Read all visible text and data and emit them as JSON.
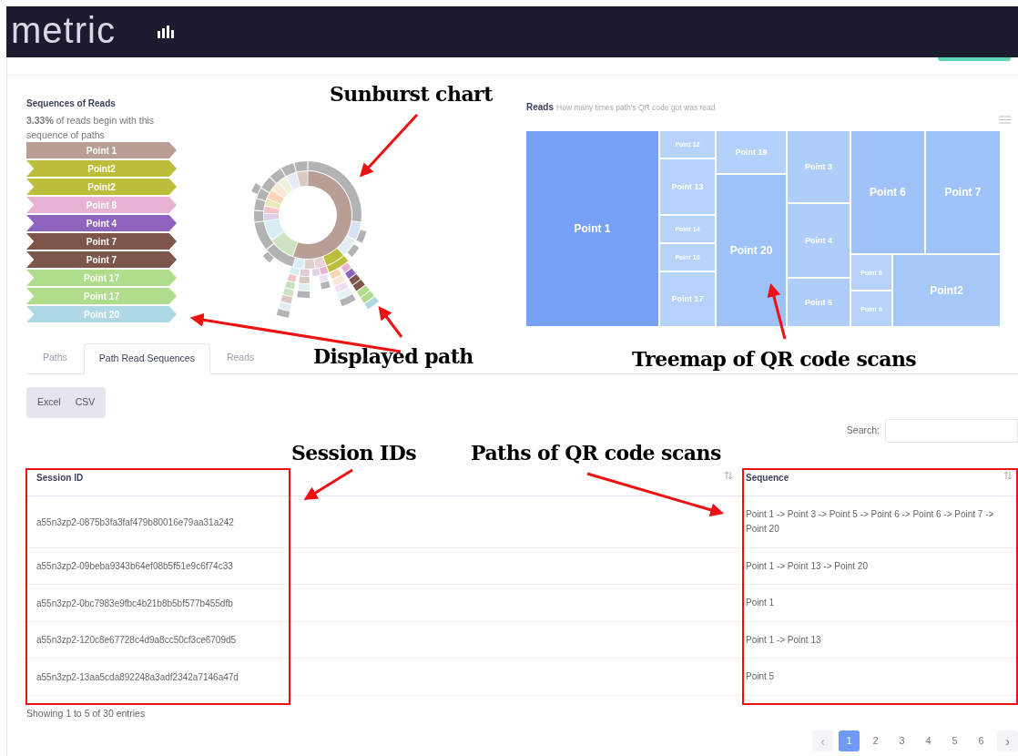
{
  "app": {
    "logo": "metric"
  },
  "sequences_panel": {
    "title": "Sequences of Reads",
    "summary": "**3.33%** of reads begin with this sequence of paths",
    "path": [
      {
        "label": "Point 1",
        "color": "#b89e94"
      },
      {
        "label": "Point2",
        "color": "#bcbd3a"
      },
      {
        "label": "Point2",
        "color": "#bcbd3a"
      },
      {
        "label": "Point 8",
        "color": "#e8b3d3"
      },
      {
        "label": "Point 4",
        "color": "#8d65bf"
      },
      {
        "label": "Point 7",
        "color": "#7d554a"
      },
      {
        "label": "Point 7",
        "color": "#7d554a"
      },
      {
        "label": "Point 17",
        "color": "#b0dd8b"
      },
      {
        "label": "Point 17",
        "color": "#b0dd8b"
      },
      {
        "label": "Point 20",
        "color": "#aed8e4"
      }
    ]
  },
  "treemap": {
    "title": "Reads",
    "subtitle": "How many times path's QR code got was read",
    "tiles": [
      {
        "label": "Point 1",
        "color": "#76a1f7"
      },
      {
        "label": "Point 12",
        "color": "#b8d3fa"
      },
      {
        "label": "Point 13",
        "color": "#b6d2fa"
      },
      {
        "label": "Point 14",
        "color": "#b8d3fa"
      },
      {
        "label": "Point 16",
        "color": "#b8d3fa"
      },
      {
        "label": "Point 17",
        "color": "#b6d2fa"
      },
      {
        "label": "Point 19",
        "color": "#b3d0fa"
      },
      {
        "label": "Point 20",
        "color": "#9dc2f8"
      },
      {
        "label": "Point 3",
        "color": "#afcdf9"
      },
      {
        "label": "Point 4",
        "color": "#afcdf9"
      },
      {
        "label": "Point 5",
        "color": "#afcdf9"
      },
      {
        "label": "Point 6",
        "color": "#9fc3f8"
      },
      {
        "label": "Point 7",
        "color": "#9fc3f8"
      },
      {
        "label": "Point 8",
        "color": "#b8d3fa"
      },
      {
        "label": "Point 9",
        "color": "#b8d3fa"
      },
      {
        "label": "Point2",
        "color": "#a6c8f9"
      }
    ]
  },
  "tabs": [
    {
      "label": "Paths",
      "selected": false
    },
    {
      "label": "Path Read Sequences",
      "selected": true
    },
    {
      "label": "Reads",
      "selected": false
    }
  ],
  "export_buttons": [
    "Excel",
    "CSV"
  ],
  "search": {
    "label": "Search:"
  },
  "table": {
    "columns": [
      "Session ID",
      "Sequence"
    ],
    "rows": [
      [
        "a55n3zp2-0875b3fa3faf479b80016e79aa31a242",
        "Point 1 -> Point 3 -> Point 5 -> Point 6 -> Point 6 -> Point 7 -> Point 20"
      ],
      [
        "a55n3zp2-09beba9343b64ef08b5f51e9c6f74c33",
        "Point 1 -> Point 13 -> Point 20"
      ],
      [
        "a55n3zp2-0bc7983e9fbc4b21b8b5bf577b455dfb",
        "Point 1"
      ],
      [
        "a55n3zp2-120c8e67728c4d9a8cc50cf3ce6709d5",
        "Point 1 -> Point 13"
      ],
      [
        "a55n3zp2-13aa5cda892248a3adf2342a7146a47d",
        "Point 5"
      ]
    ]
  },
  "table_info": "Showing 1 to 5 of 30 entries",
  "pagination": {
    "previous": "‹",
    "next": "›",
    "pages": [
      {
        "label": "1",
        "selected": true
      },
      {
        "label": "2",
        "selected": false
      },
      {
        "label": "3",
        "selected": false
      },
      {
        "label": "4",
        "selected": false
      },
      {
        "label": "5",
        "selected": false
      },
      {
        "label": "6",
        "selected": false
      }
    ]
  },
  "annotations": [
    {
      "text": "Sunburst chart"
    },
    {
      "text": "Displayed path"
    },
    {
      "text": "Treemap of QR code scans"
    },
    {
      "text": "Session IDs"
    },
    {
      "text": "Paths of QR code scans"
    }
  ]
}
